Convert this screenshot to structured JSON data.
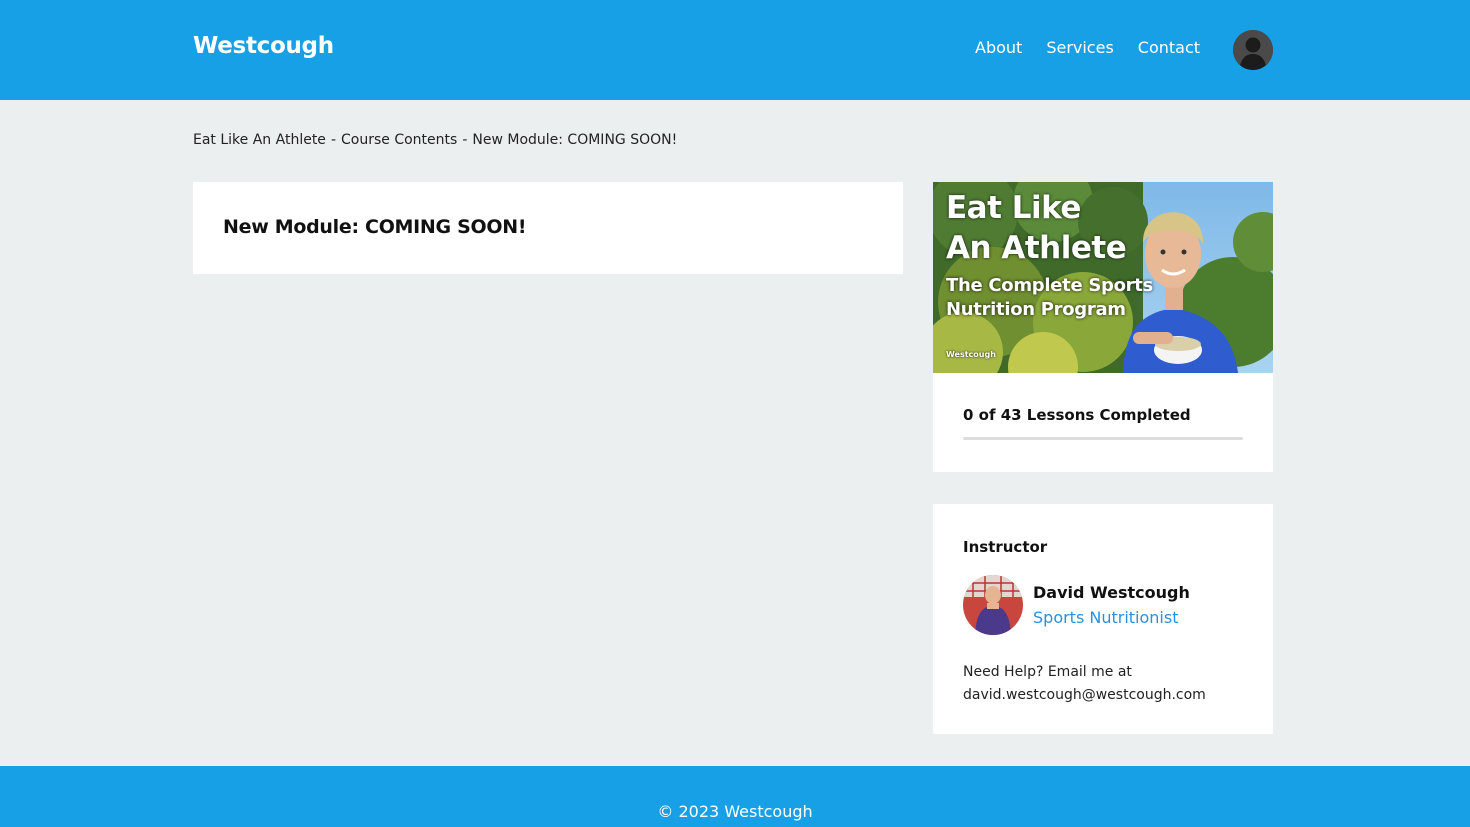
{
  "header": {
    "brand": "Westcough",
    "nav": [
      {
        "label": "About"
      },
      {
        "label": "Services"
      },
      {
        "label": "Contact"
      }
    ],
    "avatar_icon": "user-avatar-icon"
  },
  "breadcrumb": {
    "items": [
      "Eat Like An Athlete",
      "Course Contents",
      "New Module: COMING SOON!"
    ],
    "separator": "-"
  },
  "main": {
    "title": "New Module: COMING SOON!"
  },
  "course": {
    "image": {
      "title_line1": "Eat Like",
      "title_line2": "An Athlete",
      "subtitle_line1": "The Complete Sports",
      "subtitle_line2": "Nutrition Program",
      "brand": "Westcough"
    },
    "progress_text": "0 of 43 Lessons Completed",
    "progress_fraction": 0
  },
  "instructor": {
    "heading": "Instructor",
    "name": "David Westcough",
    "role": "Sports Nutritionist",
    "help_line1": "Need Help? Email me at",
    "help_line2": "david.westcough@westcough.com"
  },
  "footer": {
    "text": "© 2023 Westcough"
  },
  "colors": {
    "brand_blue": "#17a0e6",
    "page_bg": "#eceff0",
    "link_blue": "#2a8fdc"
  }
}
